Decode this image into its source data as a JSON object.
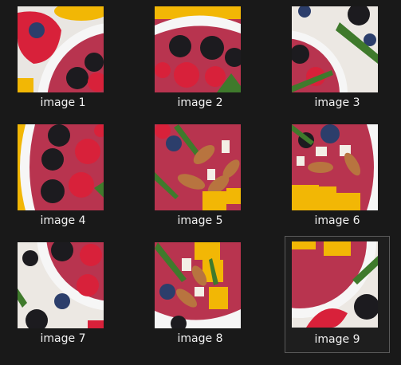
{
  "gallery": {
    "items": [
      {
        "label": "image 1",
        "selected": false
      },
      {
        "label": "image 2",
        "selected": false
      },
      {
        "label": "image 3",
        "selected": false
      },
      {
        "label": "image 4",
        "selected": false
      },
      {
        "label": "image 5",
        "selected": false
      },
      {
        "label": "image 6",
        "selected": false
      },
      {
        "label": "image 7",
        "selected": false
      },
      {
        "label": "image 8",
        "selected": false
      },
      {
        "label": "image 9",
        "selected": true
      }
    ]
  },
  "colors": {
    "background": "#191919",
    "caption": "#f2f2f2",
    "selection_border": "#5a5a5a",
    "smoothie": "#b8344f",
    "bowl": "#f4f4f4",
    "raspberry": "#d8213a",
    "blackberry": "#1c1b1f",
    "blueberry": "#2c3e6b",
    "almond": "#b8743f",
    "mango": "#f2b705",
    "coconut": "#f3efe6",
    "herb": "#3f7a2c"
  }
}
